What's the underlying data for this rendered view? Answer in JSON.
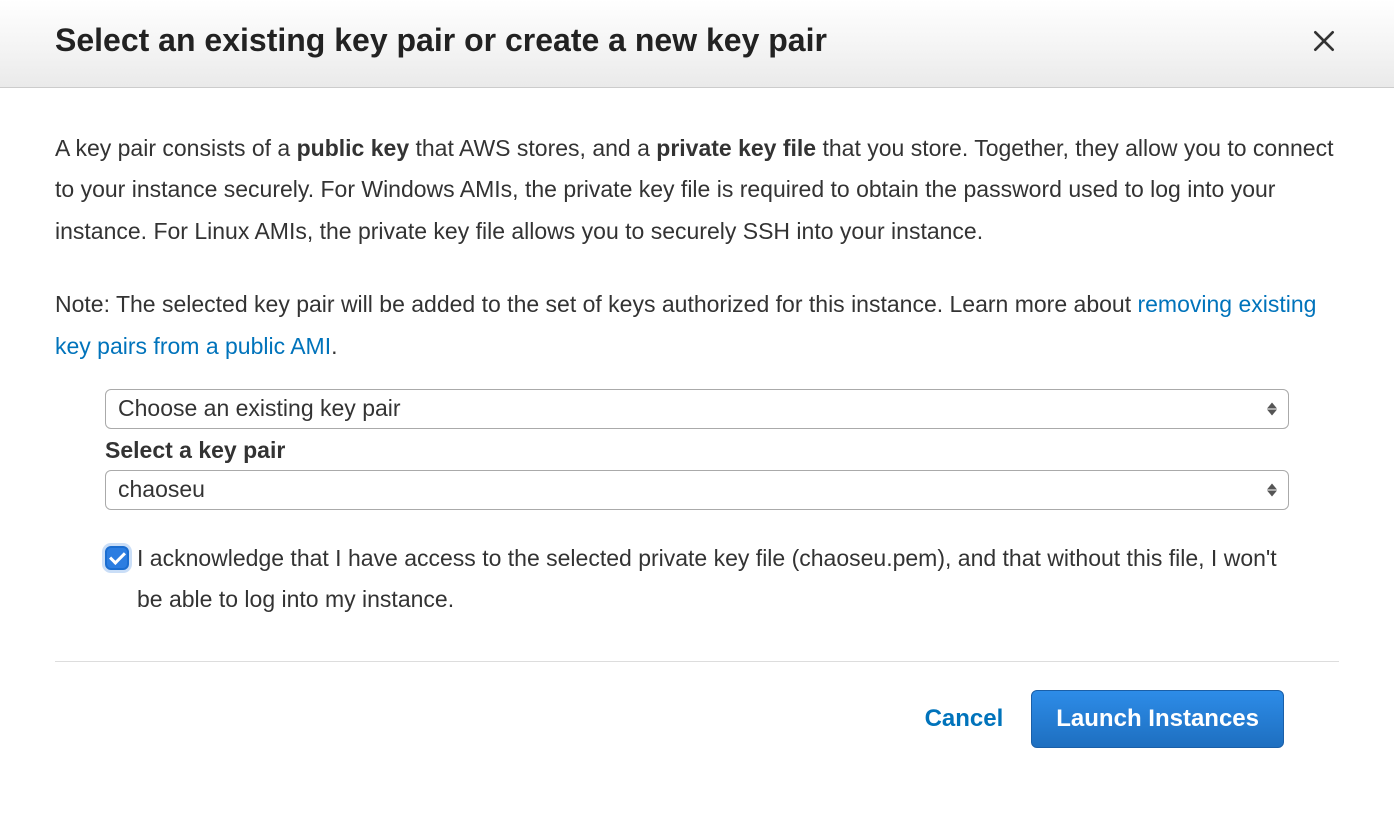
{
  "dialog": {
    "title": "Select an existing key pair or create a new key pair",
    "description": {
      "part1": "A key pair consists of a ",
      "bold1": "public key",
      "part2": " that AWS stores, and a ",
      "bold2": "private key file",
      "part3": " that you store. Together, they allow you to connect to your instance securely. For Windows AMIs, the private key file is required to obtain the password used to log into your instance. For Linux AMIs, the private key file allows you to securely SSH into your instance."
    },
    "note": {
      "prefix": "Note: The selected key pair will be added to the set of keys authorized for this instance. Learn more about ",
      "link_text": "removing existing key pairs from a public AMI",
      "suffix": "."
    },
    "keypair_mode_select": {
      "value": "Choose an existing key pair"
    },
    "keypair_select": {
      "label": "Select a key pair",
      "value": "chaoseu"
    },
    "acknowledge": {
      "checked": true,
      "text": "I acknowledge that I have access to the selected private key file (chaoseu.pem), and that without this file, I won't be able to log into my instance."
    },
    "footer": {
      "cancel": "Cancel",
      "launch": "Launch Instances"
    }
  }
}
